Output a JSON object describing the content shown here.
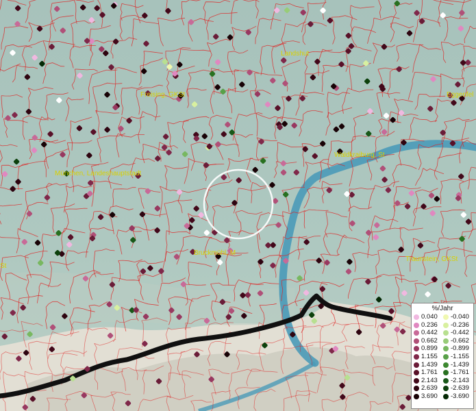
{
  "places": [
    {
      "id": "landshut",
      "label": "Landshut"
    },
    {
      "id": "freising",
      "label": "Freising, GKSt"
    },
    {
      "id": "eggenfelden",
      "label": "Eggenfel"
    },
    {
      "id": "waldkraiburg",
      "label": "Waldkraiburg, St"
    },
    {
      "id": "muenchen",
      "label": "München, Landeshauptstadt"
    },
    {
      "id": "bruckmuehl",
      "label": "Bruckmühl, M"
    },
    {
      "id": "traunstein",
      "label": "Traunstein, GKSt"
    },
    {
      "id": "left-edge",
      "label": "St"
    }
  ],
  "legend": {
    "title": "%/Jahr",
    "positive": [
      {
        "value": "0.040",
        "color": "#f0b8e0"
      },
      {
        "value": "0.236",
        "color": "#e088c0"
      },
      {
        "value": "0.442",
        "color": "#c86a98"
      },
      {
        "value": "0.662",
        "color": "#b05078"
      },
      {
        "value": "0.899",
        "color": "#983860"
      },
      {
        "value": "1.155",
        "color": "#80284a"
      },
      {
        "value": "1.439",
        "color": "#6a1c38"
      },
      {
        "value": "1.761",
        "color": "#581028"
      },
      {
        "value": "2.143",
        "color": "#42081a"
      },
      {
        "value": "2.639",
        "color": "#2e0410"
      },
      {
        "value": "3.690",
        "color": "#180206"
      }
    ],
    "negative": [
      {
        "value": "-0.040",
        "color": "#f0f8b0"
      },
      {
        "value": "-0.236",
        "color": "#d8f0a0"
      },
      {
        "value": "-0.442",
        "color": "#b8e090"
      },
      {
        "value": "-0.662",
        "color": "#98cc78"
      },
      {
        "value": "-0.899",
        "color": "#78b860"
      },
      {
        "value": "-1.155",
        "color": "#58a048"
      },
      {
        "value": "-1.439",
        "color": "#3c8830"
      },
      {
        "value": "-1.761",
        "color": "#287020"
      },
      {
        "value": "-2.143",
        "color": "#185818"
      },
      {
        "value": "-2.639",
        "color": "#0c400c"
      },
      {
        "value": "-3.690",
        "color": "#042804"
      }
    ]
  },
  "colors": {
    "terrain": "#a9c4bd",
    "mountains": "#e4e0d6",
    "boundary": "#e02020",
    "lake": "#4a9ab8",
    "border": "#101010",
    "label": "#d8d000"
  }
}
